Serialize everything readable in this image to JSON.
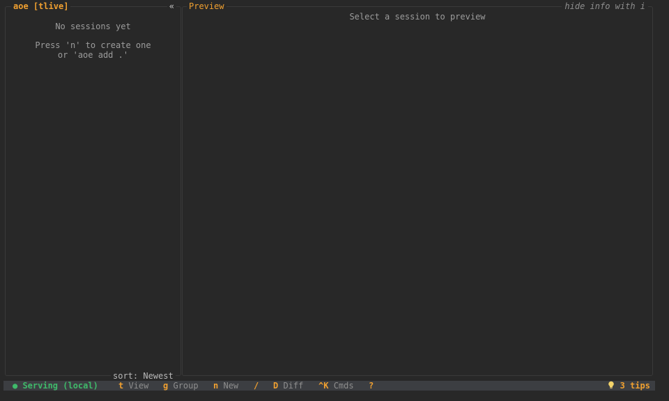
{
  "left_panel": {
    "title": "aoe [tlive]",
    "collapse_symbol": "«",
    "empty_line1": "No sessions yet",
    "empty_line2": "Press 'n' to create one",
    "empty_line3": "or 'aoe add .'",
    "sort_label": "sort: Newest"
  },
  "preview_panel": {
    "title": "Preview",
    "hint": "hide info with i",
    "message": "Select a session to preview"
  },
  "status_bar": {
    "serving": "● Serving (local)",
    "shortcuts": [
      {
        "key": "t",
        "label": "View"
      },
      {
        "key": "g",
        "label": "Group"
      },
      {
        "key": "n",
        "label": "New"
      },
      {
        "key": "/",
        "label": ""
      },
      {
        "key": "D",
        "label": "Diff"
      },
      {
        "key": "^K",
        "label": "Cmds"
      },
      {
        "key": "?",
        "label": ""
      }
    ],
    "tips_icon": "lightbulb-icon",
    "tips": "3 tips"
  },
  "colors": {
    "background": "#282828",
    "accent": "#f0a030",
    "serving_green": "#3fba6a",
    "status_bar_bg": "#3c3e42"
  }
}
